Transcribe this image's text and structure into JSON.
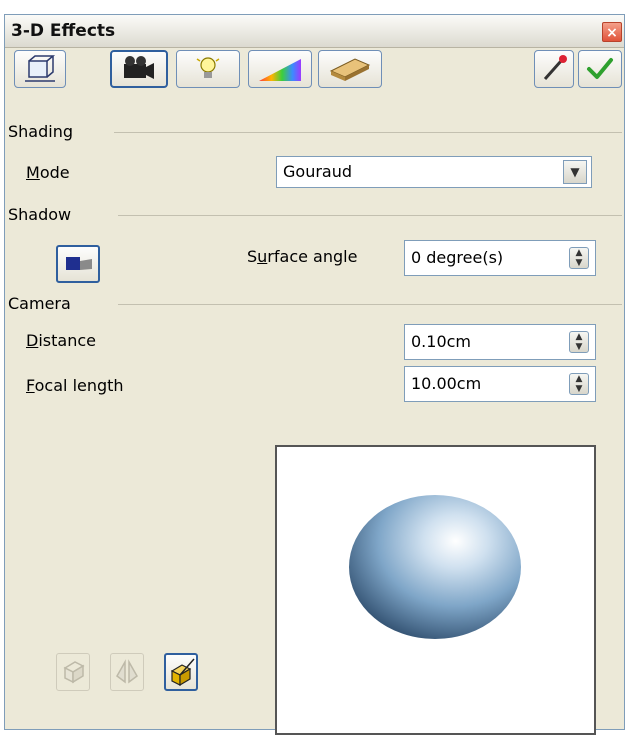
{
  "window": {
    "title": "3-D Effects",
    "close_label": "×"
  },
  "toolbar": {
    "buttons": [
      {
        "name": "geometry",
        "icon": "cube-icon"
      },
      {
        "name": "shading",
        "icon": "camera-icon"
      },
      {
        "name": "illumination",
        "icon": "lightbulb-icon"
      },
      {
        "name": "textures",
        "icon": "gradient-icon"
      },
      {
        "name": "material",
        "icon": "material-icon"
      }
    ],
    "right_buttons": [
      {
        "name": "assign",
        "icon": "eyedropper-icon"
      },
      {
        "name": "update",
        "icon": "checkmark-icon"
      }
    ]
  },
  "shading": {
    "header": "Shading",
    "mode_label": "Mode",
    "mode_value": "Gouraud"
  },
  "shadow": {
    "header": "Shadow",
    "surface_angle_label": "Surface angle",
    "surface_angle_value": "0 degree(s)"
  },
  "camera": {
    "header": "Camera",
    "distance_label": "Distance",
    "distance_value": "0.10cm",
    "focal_label": "Focal length",
    "focal_value": "10.00cm"
  },
  "colors": {
    "accent": "#2f5f9e",
    "sphere": "#7fa6c8"
  }
}
